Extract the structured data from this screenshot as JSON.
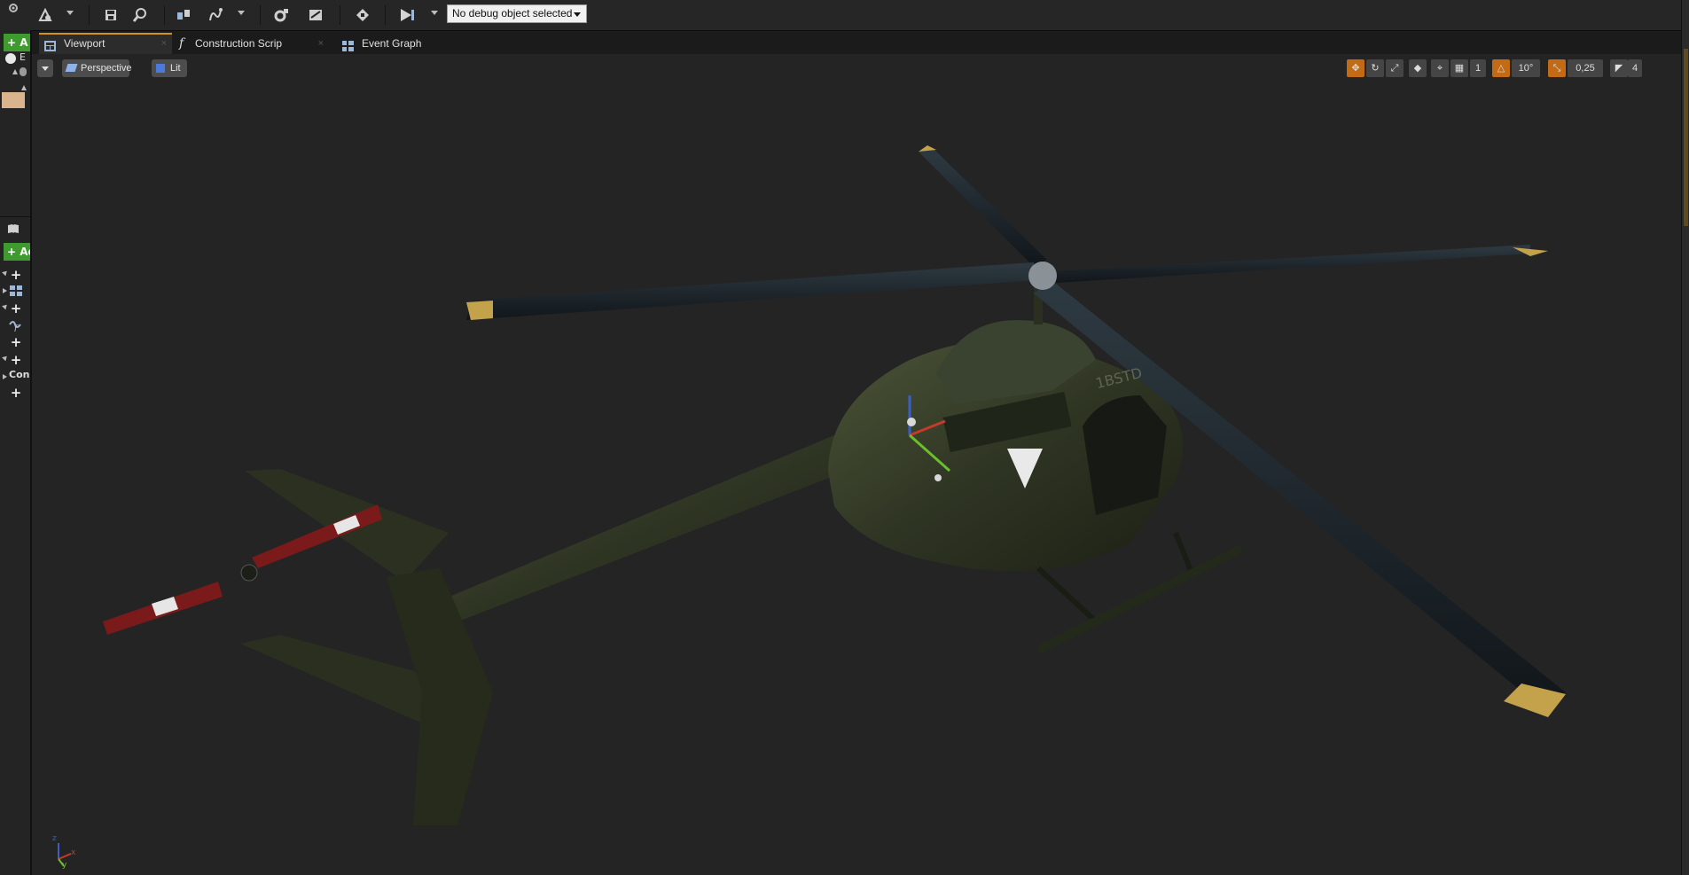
{
  "toolbar": {
    "debug_object_label": "No debug object selected"
  },
  "left_panel": {
    "add_component_label": "+ A",
    "row_label_e": "E",
    "add_button_label": "+ Ac",
    "con_label": "Con"
  },
  "tabs": [
    {
      "label": "Viewport",
      "active": true
    },
    {
      "label": "Construction Scrip",
      "active": false
    },
    {
      "label": "Event Graph",
      "active": false
    }
  ],
  "viewport_toolbar": {
    "perspective_label": "Perspective",
    "lit_label": "Lit",
    "grid_snap_value": "1",
    "rotation_snap_value": "10°",
    "scale_snap_value": "0,25",
    "camera_speed_value": "4"
  },
  "helicopter": {
    "tail_number": "1BSTD"
  },
  "axis_gizmo": {
    "z_label": "z",
    "x_label": "x",
    "y_label": "y"
  },
  "colors": {
    "accent_orange": "#c26a14",
    "tab_accent": "#d6901f",
    "add_green": "#3f9b2f",
    "viewport_bg": "#242424"
  }
}
